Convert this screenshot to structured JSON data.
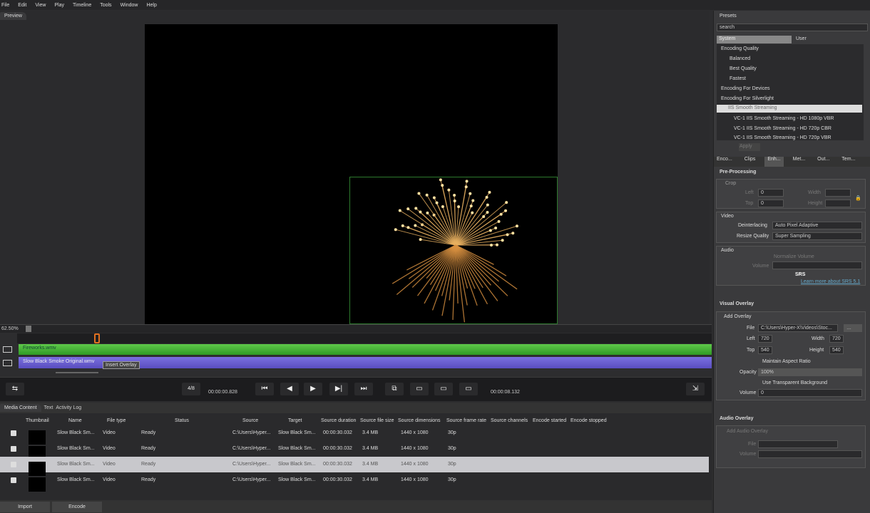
{
  "menu": [
    "File",
    "Edit",
    "View",
    "Play",
    "Timeline",
    "Tools",
    "Window",
    "Help"
  ],
  "preview_tab": "Preview",
  "timeline": {
    "zoom": "62.50%",
    "track1": "Fireworks.wmv",
    "track2": "Slow Black Smoke Original.wmv",
    "tooltip": "Insert Overlay"
  },
  "transport": {
    "frame": "4/8",
    "current_time": "00:00:00.828",
    "duration": "00:00:08.132"
  },
  "bottom_tabs": [
    "Media Content",
    "Text",
    "Activity Log"
  ],
  "columns": [
    "Thumbnail",
    "Name",
    "File type",
    "Status",
    "Source",
    "Target",
    "Source duration",
    "Source file size",
    "Source dimensions",
    "Source frame rate",
    "Source channels",
    "Encode started",
    "Encode stopped"
  ],
  "rows": [
    {
      "name": "Slow Black Sm...",
      "type": "Video",
      "status": "Ready",
      "source": "C:\\Users\\Hyper...",
      "target": "Slow Black Sm...",
      "duration": "00:00:30.032",
      "size": "3.4 MB",
      "dims": "1440 x 1080",
      "fps": "30p"
    },
    {
      "name": "Slow Black Sm...",
      "type": "Video",
      "status": "Ready",
      "source": "C:\\Users\\Hyper...",
      "target": "Slow Black Sm...",
      "duration": "00:00:30.032",
      "size": "3.4 MB",
      "dims": "1440 x 1080",
      "fps": "30p"
    },
    {
      "name": "Slow Black Sm...",
      "type": "Video",
      "status": "Ready",
      "source": "C:\\Users\\Hyper...",
      "target": "Slow Black Sm...",
      "duration": "00:00:30.032",
      "size": "3.4 MB",
      "dims": "1440 x 1080",
      "fps": "30p"
    },
    {
      "name": "Slow Black Sm...",
      "type": "Video",
      "status": "Ready",
      "source": "C:\\Users\\Hyper...",
      "target": "Slow Black Sm...",
      "duration": "00:00:30.032",
      "size": "3.4 MB",
      "dims": "1440 x 1080",
      "fps": "30p"
    }
  ],
  "footer": {
    "import": "Import",
    "encode": "Encode"
  },
  "presets": {
    "title": "Presets",
    "search": "search",
    "tabs": [
      "System",
      "User"
    ],
    "items": [
      "Encoding Quality",
      "Balanced",
      "Best Quality",
      "Fastest",
      "Encoding For Devices",
      "Encoding For Silverlight",
      "IIS Smooth Streaming",
      "VC-1 IIS Smooth Streaming - HD 1080p VBR",
      "VC-1 IIS Smooth Streaming - HD 720p CBR",
      "VC-1 IIS Smooth Streaming - HD 720p VBR"
    ],
    "apply": "Apply"
  },
  "prop_tabs": [
    "Enco...",
    "Clips",
    "Enh...",
    "Met...",
    "Out...",
    "Tem..."
  ],
  "preprocessing": {
    "title": "Pre-Processing",
    "crop": "Crop",
    "left": "Left",
    "top": "Top",
    "width": "Width",
    "height": "Height",
    "left_v": "0",
    "top_v": "0",
    "video": "Video",
    "deint": "Deinterlacing",
    "deint_v": "Auto Pixel Adaptive",
    "resize": "Resize Quality",
    "resize_v": "Super Sampling",
    "audio": "Audio",
    "normalize": "Normalize Volume",
    "volume": "Volume",
    "learn": "Learn more about SRS 5.1"
  },
  "visual_overlay": {
    "title": "Visual Overlay",
    "add": "Add Overlay",
    "file": "File",
    "file_v": "C:\\Users\\Hyper-X\\Videos\\Stoc...",
    "left": "Left",
    "left_v": "720",
    "top": "Top",
    "top_v": "540",
    "width": "Width",
    "width_v": "720",
    "height": "Height",
    "height_v": "540",
    "aspect": "Maintain Aspect Ratio",
    "opacity": "Opacity",
    "opacity_v": "100%",
    "transparent": "Use Transparent Background",
    "volume": "Volume",
    "volume_v": "0"
  },
  "audio_overlay": {
    "title": "Audio Overlay",
    "add": "Add Audio Overlay",
    "file": "File",
    "volume": "Volume"
  }
}
